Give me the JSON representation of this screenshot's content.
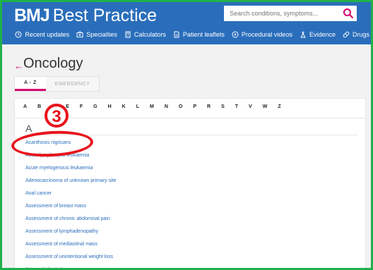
{
  "header": {
    "logo_bmj": "BMJ",
    "logo_title": "Best Practice",
    "search_placeholder": "Search conditions, symptoms...",
    "nav": [
      {
        "label": "Recent updates",
        "icon": "clock-icon"
      },
      {
        "label": "Specialties",
        "icon": "specialties-icon"
      },
      {
        "label": "Calculators",
        "icon": "calculator-icon"
      },
      {
        "label": "Patient leaflets",
        "icon": "document-icon"
      },
      {
        "label": "Procedural videos",
        "icon": "play-icon"
      },
      {
        "label": "Evidence",
        "icon": "evidence-icon"
      },
      {
        "label": "Drugs",
        "icon": "pill-icon"
      }
    ]
  },
  "page": {
    "back_arrow": "←",
    "title": "Oncology",
    "tabs": [
      "A - Z",
      "EMERGENCY"
    ]
  },
  "alphabet": [
    "A",
    "B",
    "C",
    "E",
    "F",
    "G",
    "H",
    "K",
    "L",
    "M",
    "N",
    "O",
    "P",
    "R",
    "S",
    "T",
    "V",
    "W",
    "Z"
  ],
  "section": {
    "letter": "A",
    "items": [
      "Acanthosis nigricans",
      "Acute lymphocytic leukaemia",
      "Acute myelogenous leukaemia",
      "Adenocarcinoma of unknown primary site",
      "Anal cancer",
      "Assessment of breast mass",
      "Assessment of chronic abdominal pain",
      "Assessment of lymphadenopathy",
      "Assessment of mediastinal mass",
      "Assessment of unintentional weight loss",
      "Astrocytic brain tumours"
    ]
  },
  "annotation": {
    "number": "3"
  },
  "colors": {
    "header_blue": "#2a6ebb",
    "accent_pink": "#d6006d",
    "frame_green": "#21b14b",
    "annotation_red": "#e8141c"
  }
}
